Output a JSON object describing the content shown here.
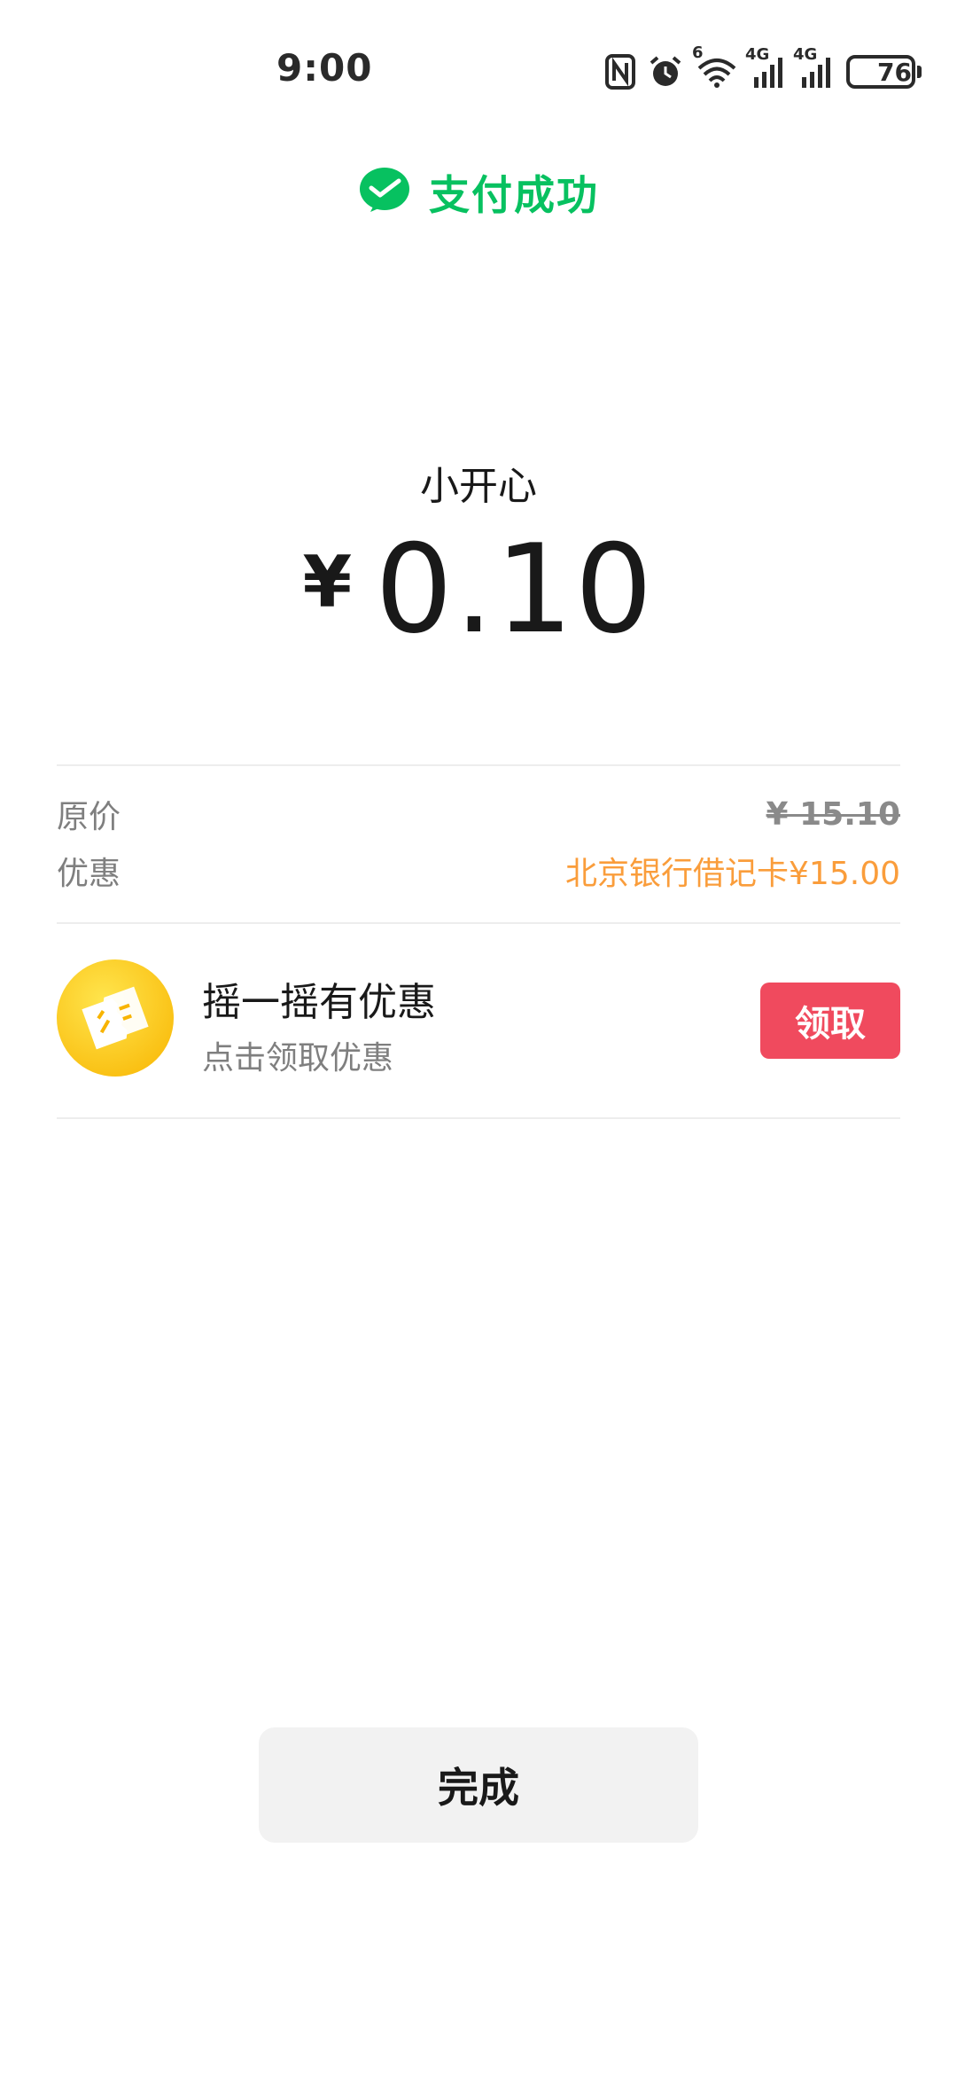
{
  "status_bar": {
    "time": "9:00",
    "wifi_tag": "6",
    "signal1_tag": "4G",
    "signal2_tag": "4G",
    "battery": "76",
    "icons": [
      "nfc-icon",
      "alarm-icon",
      "wifi-icon",
      "signal-icon",
      "signal-icon",
      "battery-icon"
    ]
  },
  "header": {
    "title": "支付成功",
    "icon": "wechat-pay-icon",
    "accent_color": "#07c160"
  },
  "payment": {
    "merchant": "小开心",
    "currency": "¥",
    "amount": "0.10"
  },
  "details": {
    "original_label": "原价",
    "original_value": "¥ 15.10",
    "discount_label": "优惠",
    "discount_value": "北京银行借记卡¥15.00",
    "discount_color": "#fa9d3b"
  },
  "promo": {
    "icon": "coupon-icon",
    "title": "摇一摇有优惠",
    "subtitle": "点击领取优惠",
    "button": "领取",
    "button_color": "#f04a5e"
  },
  "footer": {
    "done": "完成"
  }
}
